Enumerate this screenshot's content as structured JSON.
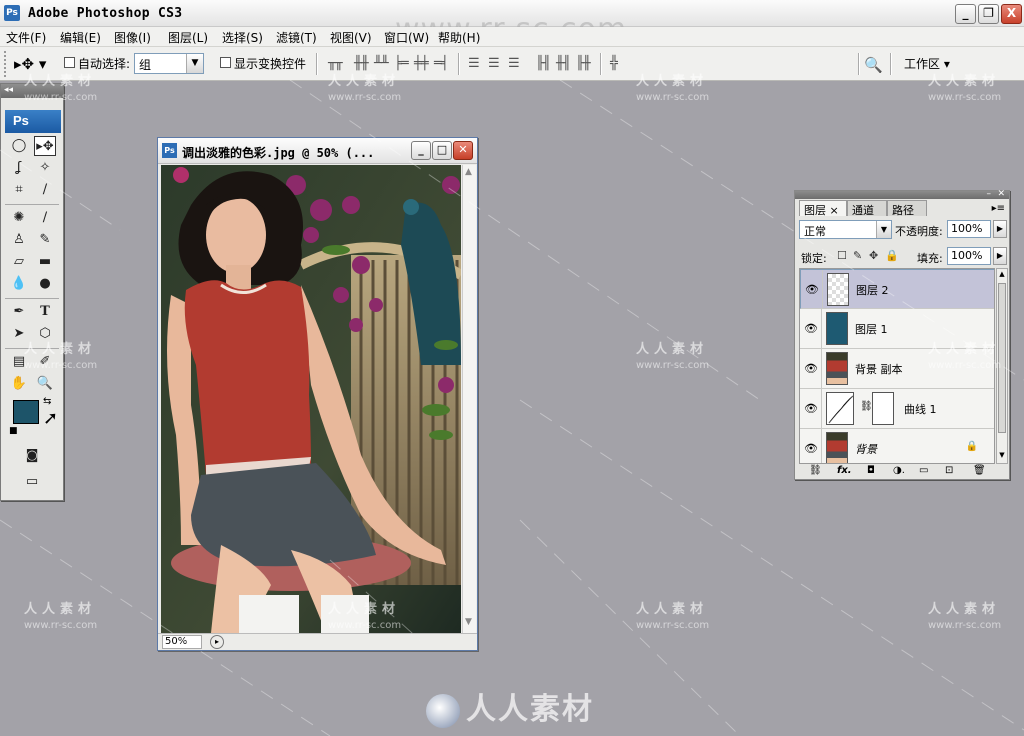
{
  "app": {
    "title": "Adobe Photoshop CS3",
    "window_controls": [
      "_",
      "❐",
      "X"
    ]
  },
  "menu": [
    "文件(F)",
    "编辑(E)",
    "图像(I)",
    "图层(L)",
    "选择(S)",
    "滤镜(T)",
    "视图(V)",
    "窗口(W)",
    "帮助(H)"
  ],
  "options": {
    "auto_select_label": "自动选择:",
    "auto_select_value": "组",
    "show_transform_label": "显示变换控件",
    "workspace_label": "工作区"
  },
  "toolbox": {
    "logo": "Ps",
    "foreground_color": "#1d5469",
    "background_color": "#fafac9"
  },
  "document": {
    "title": "调出淡雅的色彩.jpg @ 50% (...",
    "icon_text": "Ps",
    "zoom": "50%"
  },
  "layers_panel": {
    "tabs": [
      "图层",
      "通道",
      "路径"
    ],
    "blend_mode": "正常",
    "opacity_label": "不透明度:",
    "opacity": "100%",
    "lock_label": "锁定:",
    "fill_label": "填充:",
    "fill": "100%",
    "layers": [
      {
        "name": "图层 2",
        "thumb": "transparent",
        "selected": true
      },
      {
        "name": "图层 1",
        "thumb": "#1e5a72",
        "selected": false
      },
      {
        "name": "背景 副本",
        "thumb": "photo",
        "selected": false
      },
      {
        "name": "曲线 1",
        "thumb": "curves",
        "selected": false
      },
      {
        "name": "背景",
        "thumb": "photo",
        "selected": false,
        "locked": true
      }
    ]
  },
  "watermark": {
    "site": "www.rr-sc.com",
    "brand": "人人素材"
  }
}
